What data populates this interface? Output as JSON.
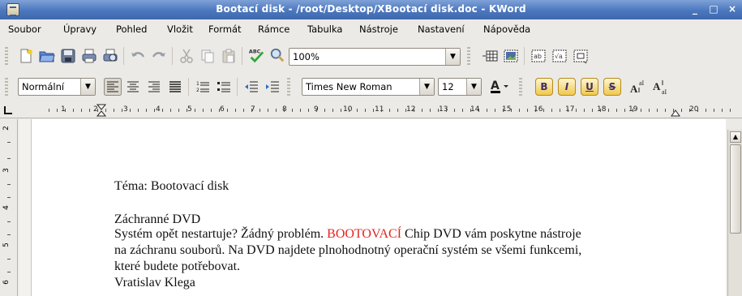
{
  "window": {
    "title": "Bootací disk - /root/Desktop/XBootací disk.doc - KWord",
    "minimize": "_",
    "maximize": "□",
    "close": "×"
  },
  "menu": [
    "Soubor",
    "Úpravy",
    "Pohled",
    "Vložit",
    "Formát",
    "Rámce",
    "Tabulka",
    "Nástroje",
    "Nastavení",
    "Nápověda"
  ],
  "toolbar": {
    "zoom": "100%"
  },
  "format_toolbar": {
    "style": "Normální",
    "font_family": "Times New Roman",
    "font_size": "12",
    "bold": "B",
    "italic": "I",
    "underline": "U",
    "strike": "S"
  },
  "ruler": {
    "h_numbers": [
      "1",
      "2",
      "3",
      "4",
      "5",
      "6",
      "7",
      "8",
      "9",
      "10",
      "11",
      "12",
      "13",
      "14",
      "15",
      "16",
      "17",
      "18",
      "19",
      "20"
    ],
    "v_numbers": [
      "2",
      "3",
      "4",
      "5",
      "6"
    ]
  },
  "document": {
    "line1": "Téma: Bootovací disk",
    "line2": "Záchranné DVD",
    "p1_before": "Systém opět nestartuje? Žádný problém. ",
    "p1_red": "BOOTOVACÍ",
    "p1_after": " Chip DVD vám poskytne nástroje",
    "p2": "na záchranu souborů. Na DVD najdete plnohodnotný operační systém se všemi funkcemi,",
    "p3": "které budete potřebovat.",
    "author": "Vratislav Klega"
  }
}
